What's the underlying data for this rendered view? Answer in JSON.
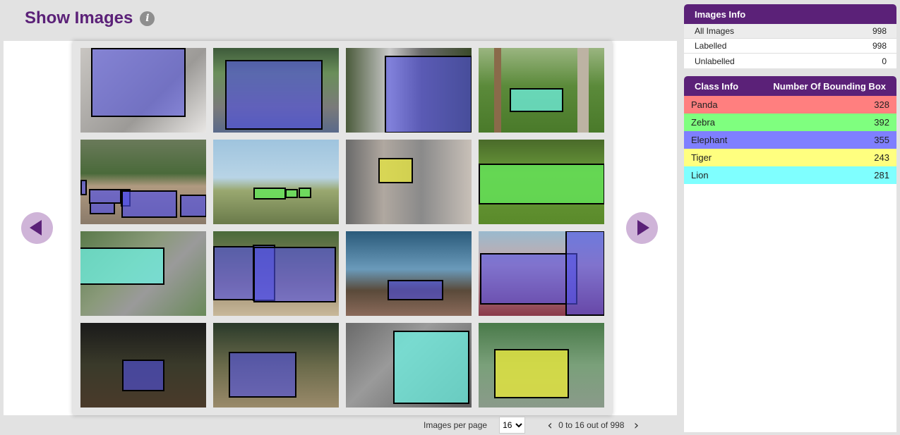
{
  "page": {
    "title": "Show Images",
    "info_icon": "info-icon"
  },
  "images_info": {
    "title": "Images Info",
    "rows": [
      {
        "label": "All Images",
        "value": "998"
      },
      {
        "label": "Labelled",
        "value": "998"
      },
      {
        "label": "Unlabelled",
        "value": "0"
      }
    ]
  },
  "class_info": {
    "title": "Class Info",
    "count_header": "Number Of Bounding Box",
    "rows": [
      {
        "label": "Panda",
        "value": "328",
        "color": "#ff7f7f"
      },
      {
        "label": "Zebra",
        "value": "392",
        "color": "#7fff7f"
      },
      {
        "label": "Elephant",
        "value": "355",
        "color": "#7f7fff"
      },
      {
        "label": "Tiger",
        "value": "243",
        "color": "#ffff7f"
      },
      {
        "label": "Lion",
        "value": "281",
        "color": "#7fffff"
      }
    ]
  },
  "pagination": {
    "per_page_label": "Images per page",
    "per_page_value": "16",
    "range_text": "0 to 16 out of 998",
    "prev_icon": "chevron-left-icon",
    "next_icon": "chevron-right-icon"
  },
  "gallery_nav": {
    "prev_icon": "arrow-left-icon",
    "next_icon": "arrow-right-icon"
  }
}
